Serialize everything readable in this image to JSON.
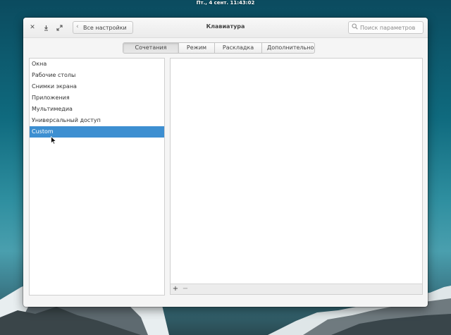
{
  "topbar": {
    "clock": "Пт., 4 сент. 11:43:02"
  },
  "titlebar": {
    "title": "Клавиатура",
    "back_label": "Все настройки",
    "search_placeholder": "Поиск параметров"
  },
  "tabs": [
    {
      "label": "Сочетания клавиш",
      "active": true
    },
    {
      "label": "Режим"
    },
    {
      "label": "Раскладка"
    },
    {
      "label": "Дополнительно"
    }
  ],
  "sections": [
    {
      "label": "Окна"
    },
    {
      "label": "Рабочие столы"
    },
    {
      "label": "Снимки экрана"
    },
    {
      "label": "Приложения"
    },
    {
      "label": "Мультимедиа"
    },
    {
      "label": "Универсальный доступ"
    },
    {
      "label": "Custom",
      "selected": true
    }
  ],
  "toolbar": {
    "add": "+",
    "remove": "−"
  },
  "colors": {
    "selection": "#3d8fd1",
    "window": "#f5f5f5"
  }
}
